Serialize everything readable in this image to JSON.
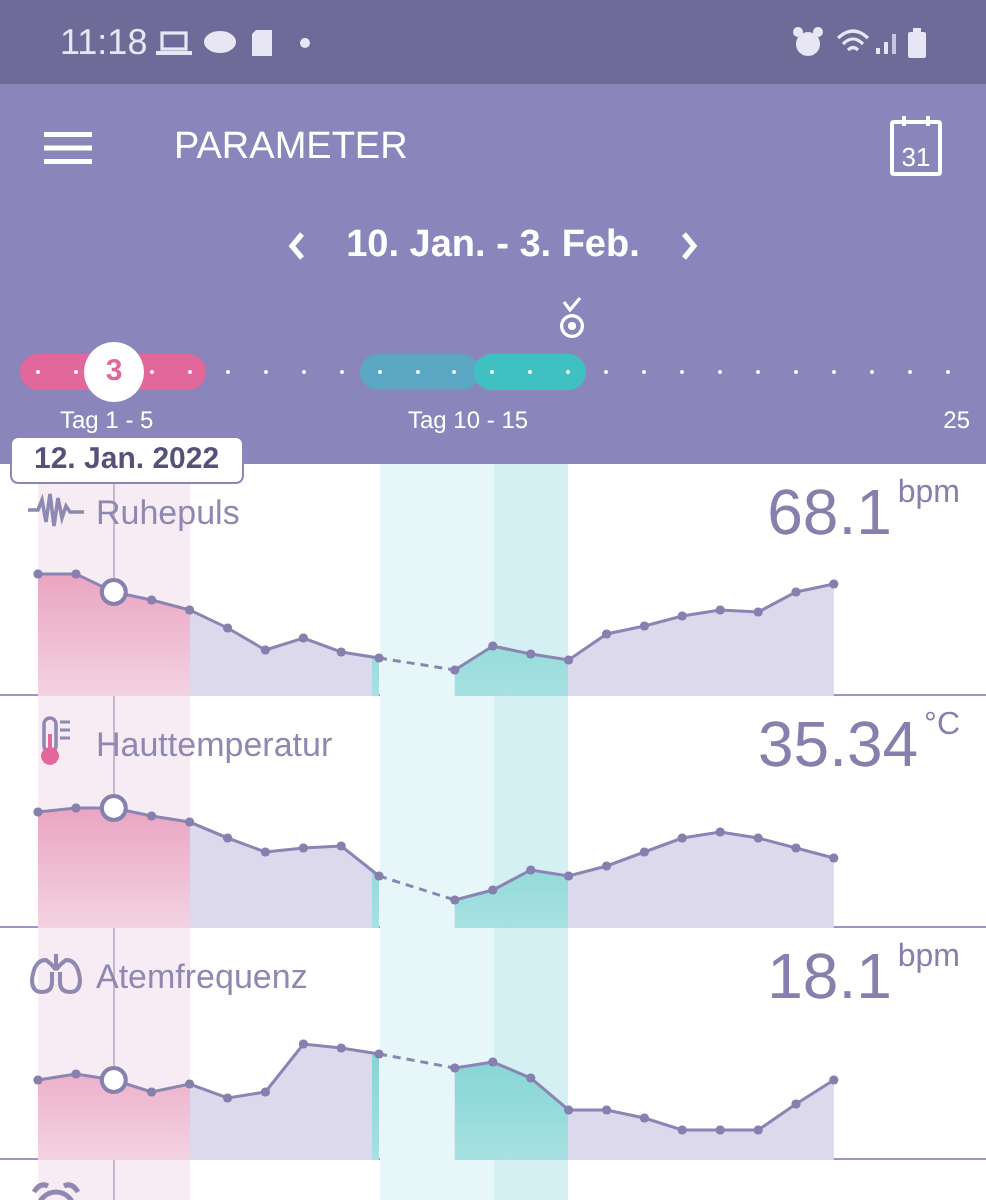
{
  "status_bar": {
    "time": "11:18"
  },
  "header": {
    "title": "PARAMETER",
    "calendar_day": "31"
  },
  "date_range": "10. Jan. - 3. Feb.",
  "cycle": {
    "selected_day": "3",
    "phases": [
      {
        "color": "#e2679a"
      },
      {
        "color": "#5ba6c2"
      },
      {
        "color": "#3fc1c1"
      }
    ],
    "labels": [
      "Tag 1 - 5",
      "Tag 10 - 15",
      "25"
    ]
  },
  "selected_date": "12. Jan. 2022",
  "parameters": [
    {
      "kind": "pulse",
      "name": "Ruhepuls",
      "value": "68.1",
      "unit": "bpm"
    },
    {
      "kind": "temperature",
      "name": "Hauttemperatur",
      "value": "35.34",
      "unit": "°C"
    },
    {
      "kind": "breathing",
      "name": "Atemfrequenz",
      "value": "18.1",
      "unit": "bpm"
    },
    {
      "kind": "sleep"
    }
  ]
}
